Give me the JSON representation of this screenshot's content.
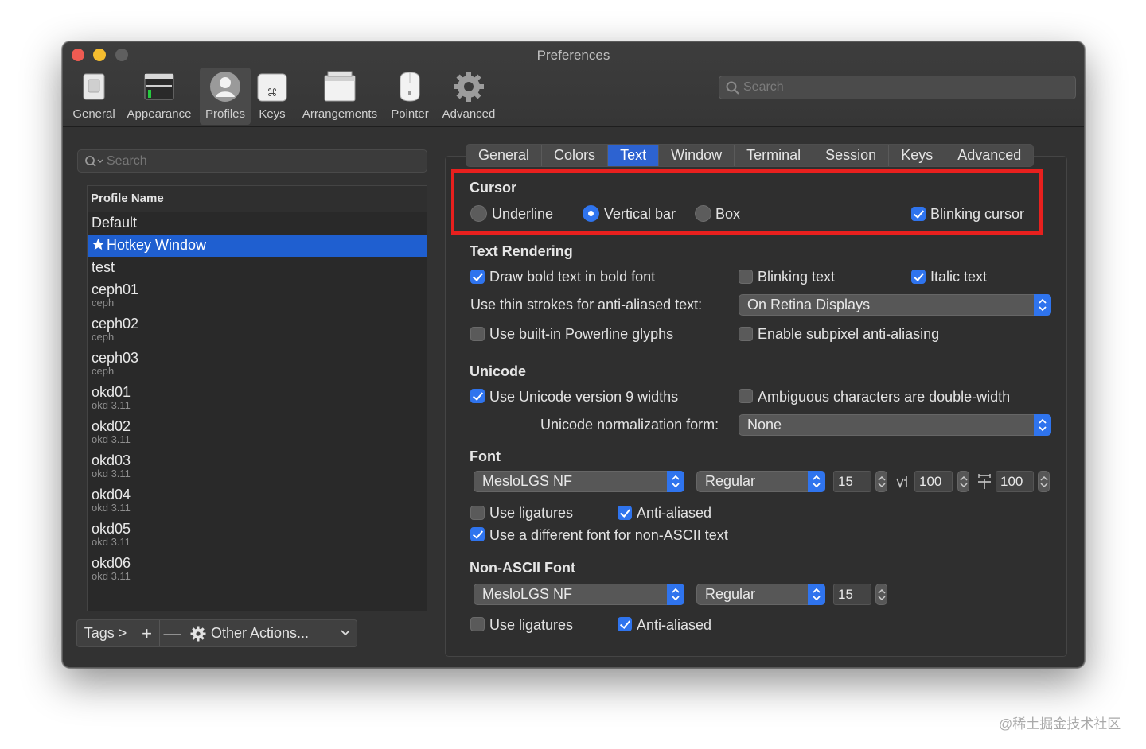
{
  "window": {
    "title": "Preferences"
  },
  "toolbar": {
    "items": [
      {
        "label": "General",
        "icon": "general-pane-icon"
      },
      {
        "label": "Appearance",
        "icon": "appearance-pane-icon"
      },
      {
        "label": "Profiles",
        "icon": "profiles-pane-icon",
        "active": true
      },
      {
        "label": "Keys",
        "icon": "keys-pane-icon"
      },
      {
        "label": "Arrangements",
        "icon": "arrangements-pane-icon"
      },
      {
        "label": "Pointer",
        "icon": "pointer-pane-icon"
      },
      {
        "label": "Advanced",
        "icon": "advanced-gear-icon"
      }
    ],
    "search_placeholder": "Search"
  },
  "profiles": {
    "search_placeholder": "Search",
    "header": "Profile Name",
    "rows": [
      {
        "name": "Default",
        "tag": ""
      },
      {
        "name": "Hotkey Window",
        "tag": "",
        "selected": true
      },
      {
        "name": "test",
        "tag": ""
      },
      {
        "name": "ceph01",
        "tag": "ceph"
      },
      {
        "name": "ceph02",
        "tag": "ceph"
      },
      {
        "name": "ceph03",
        "tag": "ceph"
      },
      {
        "name": "okd01",
        "tag": "okd 3.11"
      },
      {
        "name": "okd02",
        "tag": "okd 3.11"
      },
      {
        "name": "okd03",
        "tag": "okd 3.11"
      },
      {
        "name": "okd04",
        "tag": "okd 3.11"
      },
      {
        "name": "okd05",
        "tag": "okd 3.11"
      },
      {
        "name": "okd06",
        "tag": "okd 3.11"
      }
    ],
    "bottom": {
      "tags": "Tags >",
      "add": "+",
      "remove": "—",
      "other_actions": "Other Actions..."
    }
  },
  "tabs": [
    "General",
    "Colors",
    "Text",
    "Window",
    "Terminal",
    "Session",
    "Keys",
    "Advanced"
  ],
  "active_tab": "Text",
  "cursor": {
    "title": "Cursor",
    "underline": "Underline",
    "vertical_bar": "Vertical bar",
    "box": "Box",
    "blinking": "Blinking cursor"
  },
  "text_rendering": {
    "title": "Text Rendering",
    "bold": "Draw bold text in bold font",
    "blinking_text": "Blinking text",
    "italic": "Italic text",
    "thin_strokes_label": "Use thin strokes for anti-aliased text:",
    "thin_strokes_value": "On Retina Displays",
    "powerline": "Use built-in Powerline glyphs",
    "subpixel": "Enable subpixel anti-aliasing"
  },
  "unicode": {
    "title": "Unicode",
    "v9": "Use Unicode version 9 widths",
    "ambiguous": "Ambiguous characters are double-width",
    "normalization_label": "Unicode normalization form:",
    "normalization_value": "None"
  },
  "font": {
    "title": "Font",
    "family": "MesloLGS NF",
    "style": "Regular",
    "size": "15",
    "vertical_spacing": "100",
    "horizontal_spacing": "100",
    "ligatures": "Use ligatures",
    "antialiased": "Anti-aliased",
    "different_non_ascii": "Use a different font for non-ASCII text"
  },
  "non_ascii_font": {
    "title": "Non-ASCII Font",
    "family": "MesloLGS NF",
    "style": "Regular",
    "size": "15",
    "ligatures": "Use ligatures",
    "antialiased": "Anti-aliased"
  },
  "watermark": "@稀土掘金技术社区",
  "colors": {
    "accent": "#2f74ee",
    "selection": "#1f5fd0",
    "highlight_box": "#e8201e"
  }
}
